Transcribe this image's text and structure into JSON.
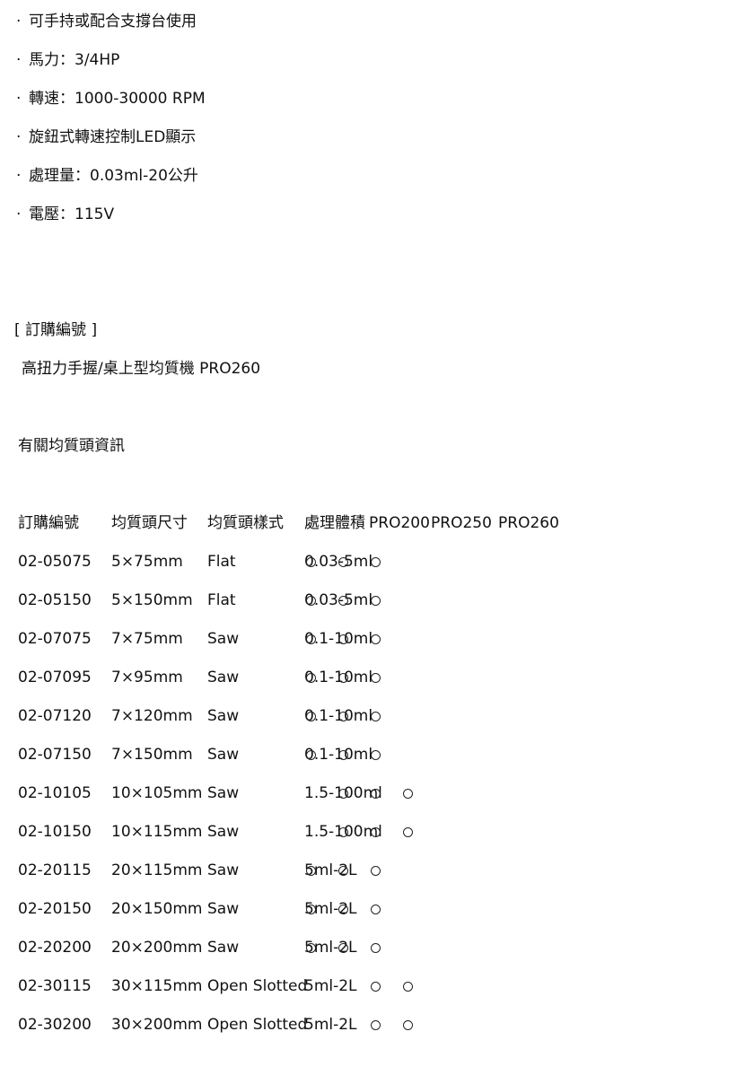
{
  "features": [
    {
      "dot": "·",
      "text": "可手持或配合支撐台使用"
    },
    {
      "dot": "·",
      "text": "馬力：3/4HP"
    },
    {
      "dot": "·",
      "text": "轉速：1000-30000 RPM"
    },
    {
      "dot": "·",
      "text": "旋鈕式轉速控制LED顯示"
    },
    {
      "dot": "·",
      "text": "處理量：0.03ml-20公升"
    },
    {
      "dot": "·",
      "text": "電壓：115V"
    }
  ],
  "order": {
    "heading": "[ 訂購編號 ]",
    "value": "高扭力手握/桌上型均質機 PRO260"
  },
  "probe_info": {
    "heading": "有關均質頭資訊",
    "columns": [
      "訂購編號",
      "均質頭尺寸",
      "均質頭樣式",
      "處理體積",
      "PRO200",
      "PRO250",
      "PRO260"
    ],
    "mark_symbol": "○",
    "rows": [
      {
        "code": "02-05075",
        "size": "5×75mm",
        "style": "Flat",
        "volume": "0.03-5ml",
        "marks": [
          true,
          true,
          true,
          false
        ]
      },
      {
        "code": "02-05150",
        "size": "5×150mm",
        "style": "Flat",
        "volume": "0.03-5ml",
        "marks": [
          true,
          true,
          true,
          false
        ]
      },
      {
        "code": "02-07075",
        "size": "7×75mm",
        "style": "Saw",
        "volume": "0.1-10ml",
        "marks": [
          true,
          true,
          true,
          false
        ]
      },
      {
        "code": "02-07095",
        "size": "7×95mm",
        "style": "Saw",
        "volume": "0.1-10ml",
        "marks": [
          true,
          true,
          true,
          false
        ]
      },
      {
        "code": "02-07120",
        "size": "7×120mm",
        "style": "Saw",
        "volume": "0.1-10ml",
        "marks": [
          true,
          true,
          true,
          false
        ]
      },
      {
        "code": "02-07150",
        "size": "7×150mm",
        "style": "Saw",
        "volume": "0.1-10ml",
        "marks": [
          true,
          true,
          true,
          false
        ]
      },
      {
        "code": "02-10105",
        "size": "10×105mm",
        "style": "Saw",
        "volume": "1.5-100ml",
        "marks": [
          false,
          true,
          true,
          true
        ]
      },
      {
        "code": "02-10150",
        "size": "10×115mm",
        "style": "Saw",
        "volume": "1.5-100ml",
        "marks": [
          false,
          true,
          true,
          true
        ]
      },
      {
        "code": "02-20115",
        "size": "20×115mm",
        "style": "Saw",
        "volume": "5ml-2L",
        "marks": [
          true,
          true,
          true,
          false
        ]
      },
      {
        "code": "02-20150",
        "size": "20×150mm",
        "style": "Saw",
        "volume": "5ml-2L",
        "marks": [
          true,
          true,
          true,
          false
        ]
      },
      {
        "code": "02-20200",
        "size": "20×200mm",
        "style": "Saw",
        "volume": "5ml-2L",
        "marks": [
          true,
          true,
          true,
          false
        ]
      },
      {
        "code": "02-30115",
        "size": "30×115mm",
        "style": "Open Slotted",
        "volume": "5ml-2L",
        "marks": [
          false,
          false,
          true,
          true
        ]
      },
      {
        "code": "02-30200",
        "size": "30×200mm",
        "style": "Open Slotted",
        "volume": "5ml-2L",
        "marks": [
          false,
          false,
          true,
          true
        ]
      }
    ]
  }
}
